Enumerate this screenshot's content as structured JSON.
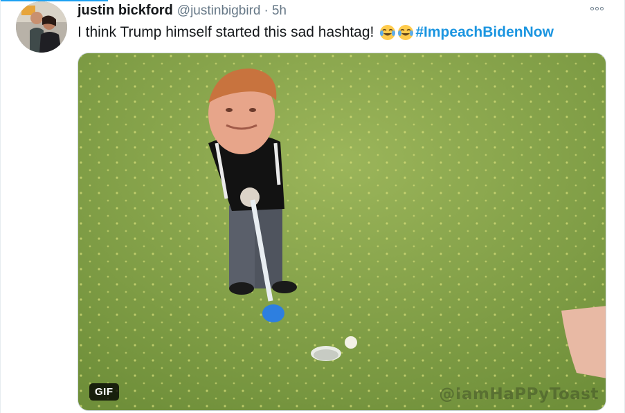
{
  "tweet": {
    "display_name": "justin bickford",
    "handle": "@justinbigbird",
    "separator": "·",
    "timestamp": "5h",
    "text": "I think Trump himself started this sad hashtag!",
    "emojis": [
      "face-with-tears-of-joy",
      "face-with-tears-of-joy"
    ],
    "hashtag": "#ImpeachBidenNow",
    "more_icon": "more-options-icon"
  },
  "media": {
    "badge": "GIF",
    "watermark": "@IamHaPPyToast"
  },
  "colors": {
    "accent": "#1da1f2",
    "hashtag": "#1b95e0",
    "text": "#14171a",
    "muted": "#657786"
  }
}
